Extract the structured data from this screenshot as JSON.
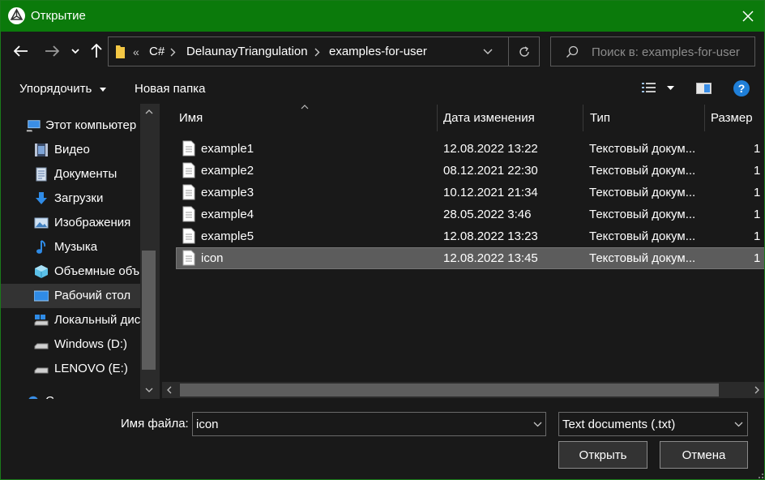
{
  "window": {
    "title": "Открытие"
  },
  "address": {
    "crumbs": [
      "C#",
      "DelaunayTriangulation",
      "examples-for-user"
    ],
    "overflow": "«"
  },
  "search": {
    "placeholder": "Поиск в: examples-for-user"
  },
  "toolbar": {
    "organize": "Упорядочить",
    "new_folder": "Новая папка"
  },
  "nav": {
    "items": [
      {
        "label": "Этот компьютер",
        "icon": "computer-icon"
      },
      {
        "label": "Видео",
        "icon": "video-folder-icon"
      },
      {
        "label": "Документы",
        "icon": "documents-folder-icon"
      },
      {
        "label": "Загрузки",
        "icon": "downloads-folder-icon"
      },
      {
        "label": "Изображения",
        "icon": "pictures-folder-icon"
      },
      {
        "label": "Музыка",
        "icon": "music-folder-icon"
      },
      {
        "label": "Объемные объ",
        "icon": "3d-objects-icon"
      },
      {
        "label": "Рабочий стол",
        "icon": "desktop-folder-icon"
      },
      {
        "label": "Локальный дис",
        "icon": "local-disk-icon"
      },
      {
        "label": "Windows (D:)",
        "icon": "drive-icon"
      },
      {
        "label": "LENOVO (E:)",
        "icon": "drive-icon"
      },
      {
        "label": "С",
        "icon": "network-icon"
      }
    ]
  },
  "columns": {
    "name": "Имя",
    "date": "Дата изменения",
    "type": "Тип",
    "size": "Размер"
  },
  "files": [
    {
      "name": "example1",
      "date": "12.08.2022 13:22",
      "type": "Текстовый докум...",
      "size": "1"
    },
    {
      "name": "example2",
      "date": "08.12.2021 22:30",
      "type": "Текстовый докум...",
      "size": "1"
    },
    {
      "name": "example3",
      "date": "10.12.2021 21:34",
      "type": "Текстовый докум...",
      "size": "1"
    },
    {
      "name": "example4",
      "date": "28.05.2022 3:46",
      "type": "Текстовый докум...",
      "size": "1"
    },
    {
      "name": "example5",
      "date": "12.08.2022 13:23",
      "type": "Текстовый докум...",
      "size": "1"
    },
    {
      "name": "icon",
      "date": "12.08.2022 13:45",
      "type": "Текстовый докум...",
      "size": "1"
    }
  ],
  "bottom": {
    "file_name_label": "Имя файла:",
    "file_name_value": "icon",
    "file_type_value": "Text documents (.txt)",
    "open_label": "Открыть",
    "cancel_label": "Отмена"
  },
  "colors": {
    "titlebar": "#0b7a0b",
    "background": "#191919",
    "selection": "#5c5c5c"
  }
}
